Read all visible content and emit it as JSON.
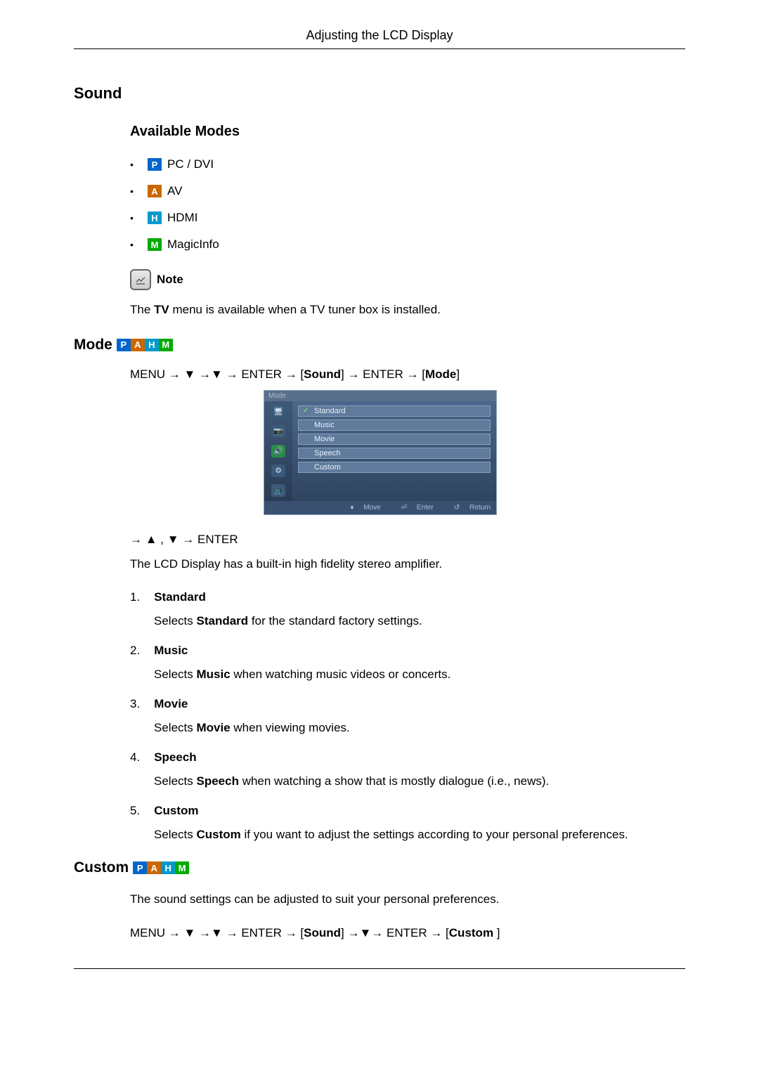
{
  "header": {
    "title": "Adjusting the LCD Display"
  },
  "sound": {
    "heading": "Sound",
    "available_modes_heading": "Available Modes",
    "modes": {
      "pc": "PC / DVI",
      "av": "AV",
      "hdmi": "HDMI",
      "magic": "MagicInfo"
    },
    "note_label": "Note",
    "note_text_prefix": "The ",
    "note_text_bold": "TV",
    "note_text_suffix": " menu is available when a TV tuner box is installed."
  },
  "mode_section": {
    "heading": "Mode",
    "path_prefix": "MENU → ▼ →▼ → ENTER → [",
    "path_bold1": "Sound",
    "path_mid": "] → ENTER → [",
    "path_bold2": "Mode",
    "path_suffix": "]",
    "osd": {
      "title": "Mode",
      "options": [
        "Standard",
        "Music",
        "Movie",
        "Speech",
        "Custom"
      ],
      "selected_index": 0,
      "footer": {
        "move": "Move",
        "enter": "Enter",
        "return": "Return"
      }
    },
    "nav_line": "→ ▲ , ▼ → ENTER",
    "intro": "The LCD Display has a built-in high fidelity stereo amplifier.",
    "items": [
      {
        "n": "1",
        "title": "Standard",
        "desc_pre": "Selects ",
        "desc_bold": "Standard",
        "desc_post": " for the standard factory settings."
      },
      {
        "n": "2",
        "title": "Music",
        "desc_pre": "Selects ",
        "desc_bold": "Music",
        "desc_post": " when watching music videos or concerts."
      },
      {
        "n": "3",
        "title": "Movie",
        "desc_pre": "Selects ",
        "desc_bold": "Movie",
        "desc_post": " when viewing movies."
      },
      {
        "n": "4",
        "title": "Speech",
        "desc_pre": "Selects ",
        "desc_bold": "Speech",
        "desc_post": " when watching a show that is mostly dialogue (i.e., news)."
      },
      {
        "n": "5",
        "title": "Custom",
        "desc_pre": "Selects ",
        "desc_bold": "Custom",
        "desc_post": " if you want to adjust the settings according to your personal preferences."
      }
    ]
  },
  "custom_section": {
    "heading": "Custom",
    "intro": "The sound settings can be adjusted to suit your personal preferences.",
    "path_prefix": "MENU → ▼ →▼ → ENTER → [",
    "path_bold1": "Sound",
    "path_mid": "] →▼→ ENTER → [",
    "path_bold2": "Custom ",
    "path_suffix": "]"
  },
  "badges": {
    "p": "P",
    "a": "A",
    "h": "H",
    "m": "M"
  }
}
